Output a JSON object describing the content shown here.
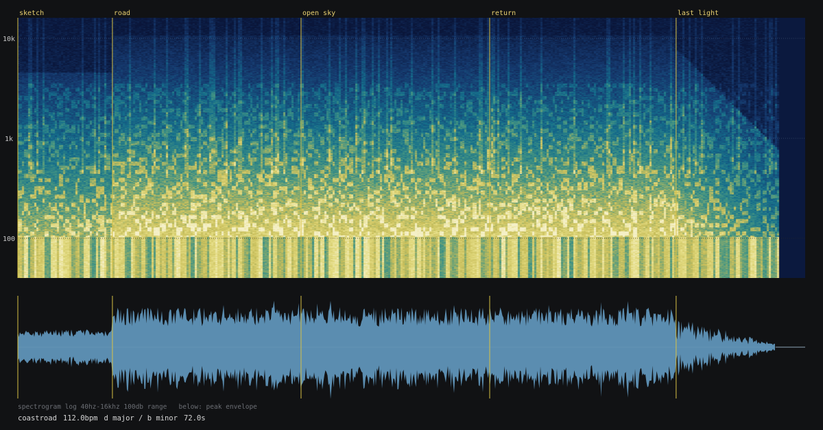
{
  "spectrogram": {
    "freq_labels": [
      "10k",
      "1k",
      "100"
    ],
    "caption": "spectrogram log 40hz-16khz 100db range   below: peak envelope"
  },
  "sections": [
    {
      "label": "sketch",
      "start_s": 0.0
    },
    {
      "label": "road",
      "start_s": 8.65
    },
    {
      "label": "open sky",
      "start_s": 25.9
    },
    {
      "label": "return",
      "start_s": 43.15
    },
    {
      "label": "last light",
      "start_s": 60.2
    }
  ],
  "track": {
    "name": "coastroad",
    "bpm": "112.0bpm",
    "key": "d major / b minor",
    "duration": "72.0s"
  },
  "colors": {
    "background": "#111214",
    "marker": "#d9c245",
    "waveform": "#5b8db0",
    "label": "#e8d070"
  }
}
